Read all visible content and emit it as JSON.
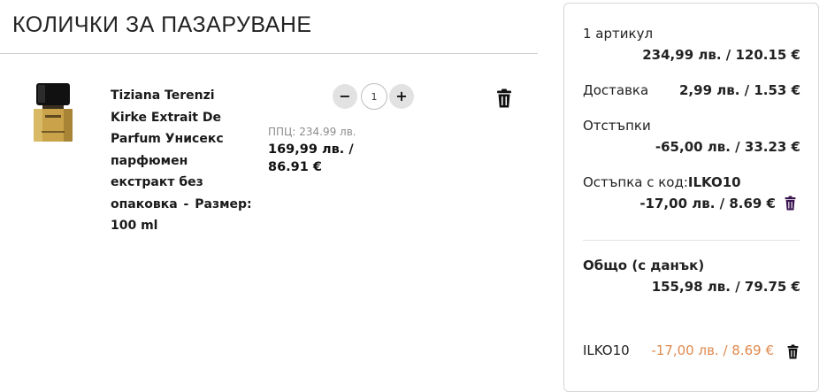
{
  "cart": {
    "title": "КОЛИЧКИ ЗА ПАЗАРУВАНЕ",
    "item": {
      "name": "Tiziana Terenzi Kirke Extrait De Parfum Унисекс парфюмен екстракт без опаковка",
      "separator": "-",
      "size_label": "Размер:",
      "size_value": "100 ml",
      "rrp": "ППЦ: 234.99 лв.",
      "price": "169,99 лв. / 86.91 €",
      "quantity": "1",
      "qty_minus": "−",
      "qty_plus": "+",
      "image_icon": "perfume-bottle-icon",
      "remove_icon": "trash-icon"
    }
  },
  "summary": {
    "items_label": "1 артикул",
    "items_value": "234,99 лв. / 120.15 €",
    "delivery_label": "Доставка",
    "delivery_value": "2,99 лв. / 1.53 €",
    "discounts_label": "Отстъпки",
    "discounts_value": "-65,00 лв. / 33.23 €",
    "coupon_label": "Остъпка с код:",
    "coupon_code": "ILKO10",
    "coupon_value": "-17,00 лв. / 8.69 €",
    "total_label": "Общо (с данък)",
    "total_value": "155,98 лв. / 79.75 €",
    "promo_code": "ILKO10",
    "promo_discount": "-17,00 лв. / 8.69 €",
    "colors": {
      "coupon_trash": "#3a1550",
      "promo_discount": "#e08a4f",
      "accent_gold": "#c9a24a"
    }
  }
}
